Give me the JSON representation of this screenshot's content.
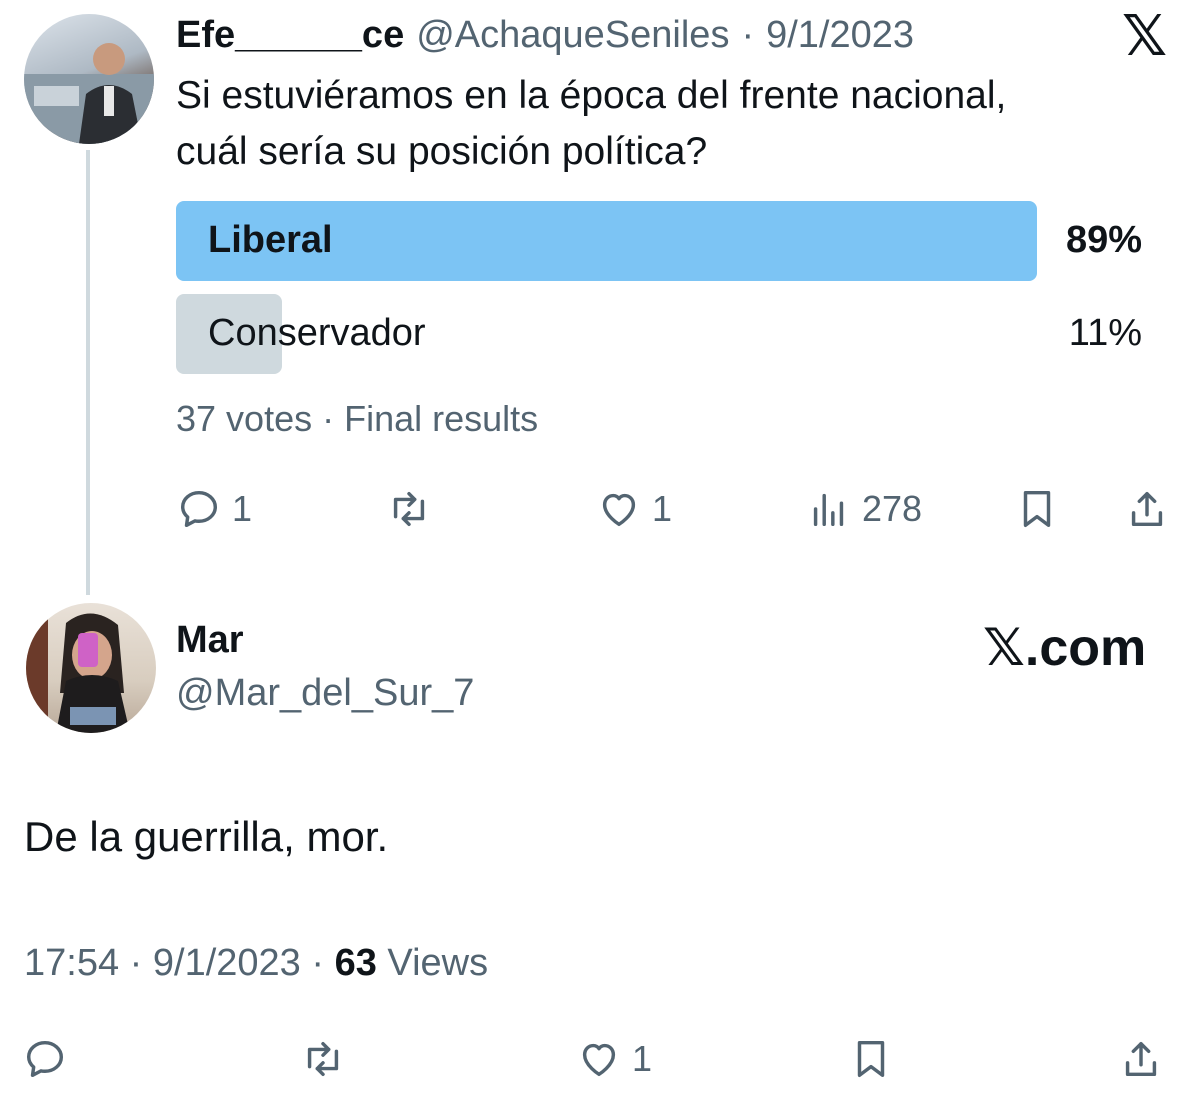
{
  "original_tweet": {
    "display_name": "Efe______ce",
    "handle": "@AchaqueSeniles",
    "separator": "·",
    "date": "9/1/2023",
    "text_line1": "Si estuviéramos en la época del frente nacional,",
    "text_line2": "cuál sería su posición política?",
    "poll": {
      "options": [
        {
          "label": "Liberal",
          "percent_text": "89%",
          "percent": 89,
          "winner": true
        },
        {
          "label": "Conservador",
          "percent_text": "11%",
          "percent": 11,
          "winner": false
        }
      ],
      "summary": "37 votes · Final results"
    },
    "actions": {
      "replies": "1",
      "likes": "1",
      "views": "278"
    }
  },
  "reply_tweet": {
    "display_name": "Mar",
    "handle": "@Mar_del_Sur_7",
    "text": "De la guerrilla, mor.",
    "time": "17:54",
    "date": "9/1/2023",
    "views_count": "63",
    "views_label": "Views",
    "actions": {
      "likes": "1"
    }
  },
  "branding": {
    "x_glyph": "𝕏",
    "site": ".com"
  },
  "colors": {
    "winner_bar": "#7cc4f4",
    "loser_bar": "#cfd9de",
    "muted": "#536471"
  },
  "icons": [
    "reply-icon",
    "retweet-icon",
    "like-icon",
    "views-icon",
    "bookmark-icon",
    "share-icon",
    "x-logo-icon"
  ]
}
